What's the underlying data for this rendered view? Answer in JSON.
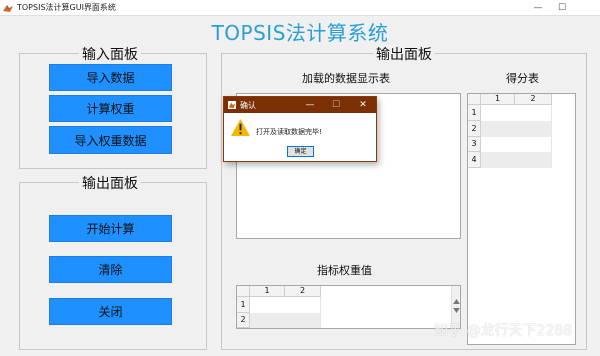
{
  "window": {
    "title": "TOPSIS法计算GUI界面系统",
    "minimize": "—",
    "maximize": "☐"
  },
  "app": {
    "title": "TOPSIS法计算系统",
    "title_color": "#2a9fd6"
  },
  "input_panel": {
    "title": "输入面板",
    "buttons": [
      "导入数据",
      "计算权重",
      "导入权重数据"
    ]
  },
  "output_panel_left": {
    "title": "输出面板",
    "buttons": [
      "开始计算",
      "清除",
      "关闭"
    ]
  },
  "output_panel_right": {
    "title": "输出面板",
    "data_table_label": "加载的数据显示表",
    "score_table": {
      "label": "得分表",
      "columns": [
        "1",
        "2"
      ],
      "rows": [
        "1",
        "2",
        "3",
        "4"
      ]
    },
    "weight_table": {
      "label": "指标权重值",
      "columns": [
        "1",
        "2"
      ],
      "rows": [
        "1",
        "2"
      ]
    }
  },
  "dialog": {
    "title": "确认",
    "message": "打开及读取数据完毕!",
    "ok": "确定",
    "close": "✕",
    "minimize": "—",
    "maximize": "☐"
  },
  "watermark": "知乎 @龙行天下2288",
  "colors": {
    "button_blue": "#1e90ff",
    "dialog_titlebar": "#7a2f05",
    "warning": "#f5b800"
  }
}
